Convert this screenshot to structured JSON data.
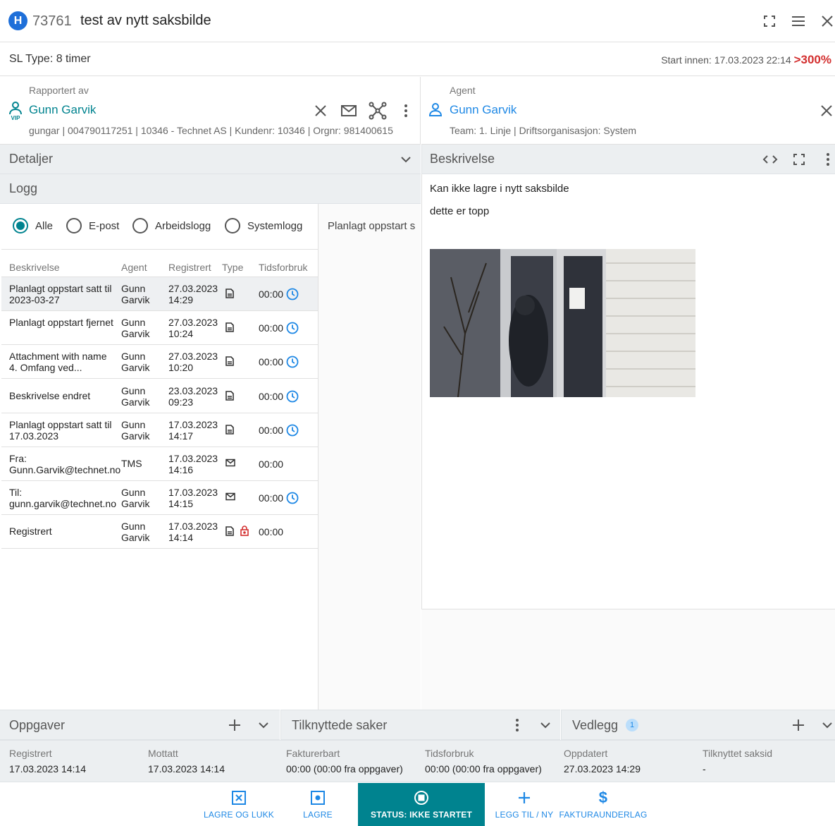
{
  "header": {
    "badge": "H",
    "case_number": "73761",
    "title": "test av nytt saksbilde"
  },
  "subheader": {
    "sl_type": "SL Type: 8 timer",
    "start_label": "Start innen: 17.03.2023 22:14",
    "overdue": ">300%"
  },
  "reported_by": {
    "label": "Rapportert av",
    "name": "Gunn Garvik",
    "details": "gungar | 004790117251 | 10346 - Technet AS | Kundenr: 10346 | Orgnr: 981400615",
    "vip": "VIP"
  },
  "agent": {
    "label": "Agent",
    "name": "Gunn Garvik",
    "details": "Team: 1. Linje | Driftsorganisasjon: System"
  },
  "sections": {
    "details": "Detaljer",
    "log": "Logg",
    "description": "Beskrivelse"
  },
  "filters": [
    "Alle",
    "E-post",
    "Arbeidslogg",
    "Systemlogg"
  ],
  "log_table": {
    "headers": [
      "Beskrivelse",
      "Agent",
      "Registrert",
      "Type",
      "Tidsforbruk"
    ],
    "rows": [
      {
        "desc": "Planlagt oppstart satt til 2023-03-27",
        "agent": "Gunn Garvik",
        "reg": "27.03.2023 14:29",
        "type": "doc",
        "time": "00:00",
        "clock": true,
        "lock": false
      },
      {
        "desc": "Planlagt oppstart fjernet",
        "agent": "Gunn Garvik",
        "reg": "27.03.2023 10:24",
        "type": "doc",
        "time": "00:00",
        "clock": true,
        "lock": false
      },
      {
        "desc": "Attachment with name 4. Omfang ved...",
        "agent": "Gunn Garvik",
        "reg": "27.03.2023 10:20",
        "type": "doc",
        "time": "00:00",
        "clock": true,
        "lock": false
      },
      {
        "desc": "Beskrivelse endret",
        "agent": "Gunn Garvik",
        "reg": "23.03.2023 09:23",
        "type": "doc",
        "time": "00:00",
        "clock": true,
        "lock": false
      },
      {
        "desc": "Planlagt oppstart satt til 17.03.2023",
        "agent": "Gunn Garvik",
        "reg": "17.03.2023 14:17",
        "type": "doc",
        "time": "00:00",
        "clock": true,
        "lock": false
      },
      {
        "desc": "Fra: Gunn.Garvik@technet.no",
        "agent": "TMS",
        "reg": "17.03.2023 14:16",
        "type": "mail",
        "time": "00:00",
        "clock": false,
        "lock": false
      },
      {
        "desc": "Til: gunn.garvik@technet.no",
        "agent": "Gunn Garvik",
        "reg": "17.03.2023 14:15",
        "type": "mail",
        "time": "00:00",
        "clock": true,
        "lock": false
      },
      {
        "desc": "Registrert",
        "agent": "Gunn Garvik",
        "reg": "17.03.2023 14:14",
        "type": "doc",
        "time": "00:00",
        "clock": false,
        "lock": true
      }
    ]
  },
  "log_preview": "Planlagt oppstart s",
  "description": {
    "line1": "Kan ikke lagre i nytt saksbilde",
    "line2": "dette er topp"
  },
  "bottom_sections": {
    "tasks": "Oppgaver",
    "related": "Tilknyttede saker",
    "attachments": "Vedlegg",
    "attachments_count": "1"
  },
  "info": [
    {
      "label": "Registrert",
      "value": "17.03.2023 14:14"
    },
    {
      "label": "Mottatt",
      "value": "17.03.2023 14:14"
    },
    {
      "label": "Fakturerbart",
      "value": "00:00 (00:00 fra oppgaver)"
    },
    {
      "label": "Tidsforbruk",
      "value": "00:00 (00:00 fra oppgaver)"
    },
    {
      "label": "Oppdatert",
      "value": "27.03.2023 14:29"
    },
    {
      "label": "Tilknyttet saksid",
      "value": "-"
    }
  ],
  "actions": {
    "save_close": "LAGRE OG LUKK",
    "save": "LAGRE",
    "status": "STATUS: IKKE STARTET",
    "add_new": "LEGG TIL / NY",
    "invoice": "FAKTURAUNDERLAG"
  },
  "colors": {
    "teal": "#00838f",
    "blue": "#1e88e5",
    "overdue_red": "#d32f2f",
    "status_bg": "#00838f"
  }
}
